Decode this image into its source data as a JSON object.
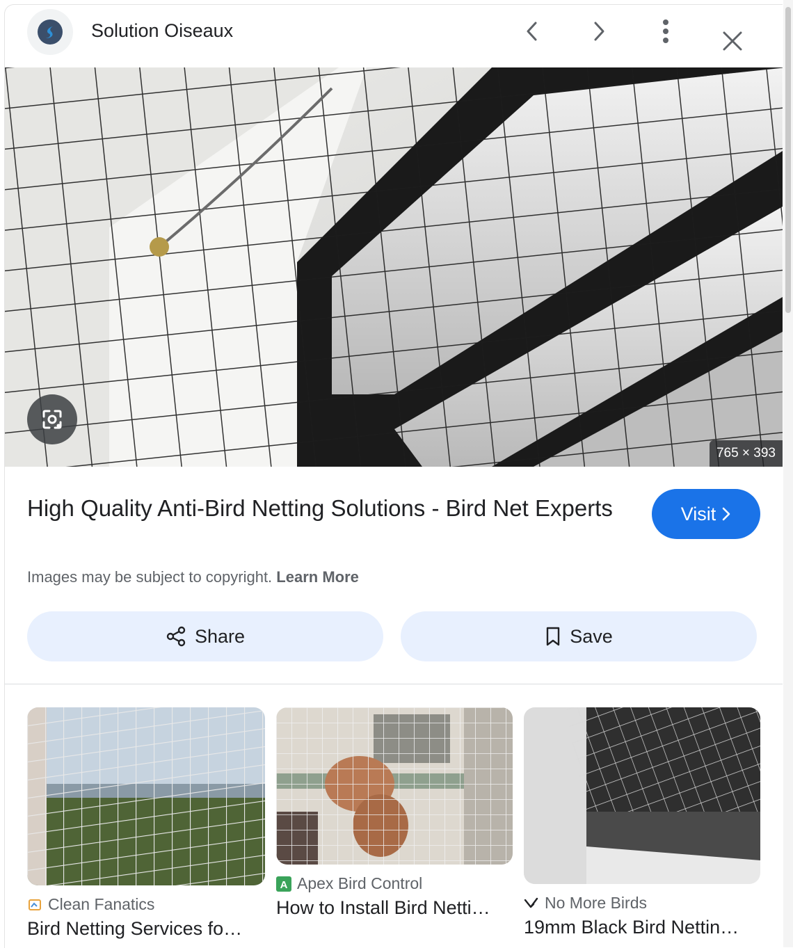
{
  "header": {
    "site_name": "Solution Oiseaux",
    "prev_label": "Previous",
    "next_label": "Next",
    "more_label": "More options",
    "close_label": "Close"
  },
  "image": {
    "dimensions": "765 × 393"
  },
  "result": {
    "title": "High Quality Anti-Bird Netting Solutions - Bird Net Experts",
    "visit_label": "Visit",
    "copyright_text": "Images may be subject to copyright.",
    "learn_more": "Learn More"
  },
  "actions": {
    "share_label": "Share",
    "save_label": "Save"
  },
  "related": [
    {
      "source": "Clean Fanatics",
      "caption": "Bird Netting Services fo…"
    },
    {
      "source": "Apex Bird Control",
      "caption": "How to Install Bird Netti…"
    },
    {
      "source": "No More Birds",
      "caption": "19mm Black Bird Nettin…"
    }
  ],
  "colors": {
    "accent": "#1a73e8",
    "action_bg": "#e8f0fe"
  }
}
